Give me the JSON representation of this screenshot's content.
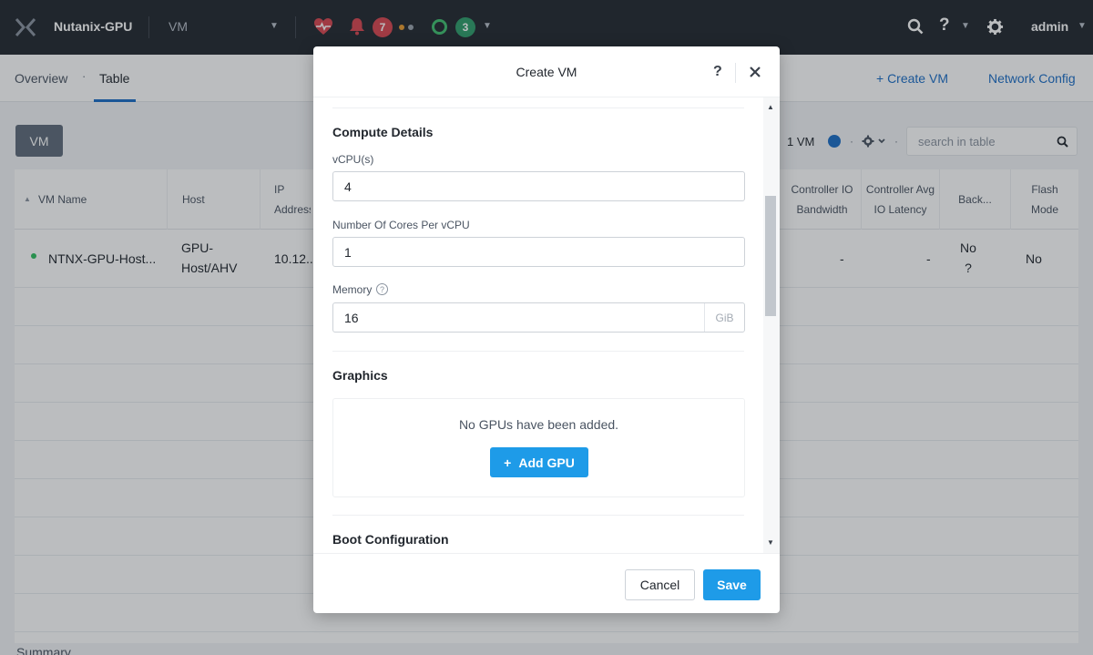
{
  "topbar": {
    "cluster_name": "Nutanix-GPU",
    "entity_menu": "VM",
    "alerts_count": "7",
    "tasks_count": "3",
    "help_label": "?",
    "user": "admin"
  },
  "subnav": {
    "tabs": [
      {
        "label": "Overview"
      },
      {
        "label": "Table"
      }
    ],
    "separator": "·",
    "create_vm": "+ Create VM",
    "network_config": "Network Config"
  },
  "toolbar": {
    "vm_button": "VM",
    "count": "1 VM",
    "search_placeholder": "search in table"
  },
  "table": {
    "columns": [
      {
        "label": "VM Name"
      },
      {
        "label": "Host"
      },
      {
        "label": "IP Address"
      },
      {
        "label": "Controller IO Bandwidth"
      },
      {
        "label": "Controller Avg IO Latency"
      },
      {
        "label": "Back..."
      },
      {
        "label": "Flash Mode"
      }
    ],
    "rows": [
      {
        "vm_name": "NTNX-GPU-Host...",
        "host": "GPU-Host/AHV",
        "ip": "10.12...",
        "io_bandwidth": "-",
        "io_latency": "-",
        "backup": "No ?",
        "flash_mode": "No"
      }
    ]
  },
  "summary_label": "Summary",
  "modal": {
    "title": "Create VM",
    "help": "?",
    "compute_title": "Compute Details",
    "vcpu_label": "vCPU(s)",
    "vcpu_value": "4",
    "cores_label": "Number Of Cores Per vCPU",
    "cores_value": "1",
    "memory_label": "Memory",
    "memory_value": "16",
    "memory_unit": "GiB",
    "graphics_title": "Graphics",
    "no_gpus": "No GPUs have been added.",
    "add_gpu": "Add GPU",
    "boot_title": "Boot Configuration",
    "cancel": "Cancel",
    "save": "Save"
  },
  "colors": {
    "topbar": "#22272e",
    "primary": "#1e9be8",
    "link": "#1b6dc6",
    "alert": "#d94650",
    "ok": "#2f9d6a"
  }
}
